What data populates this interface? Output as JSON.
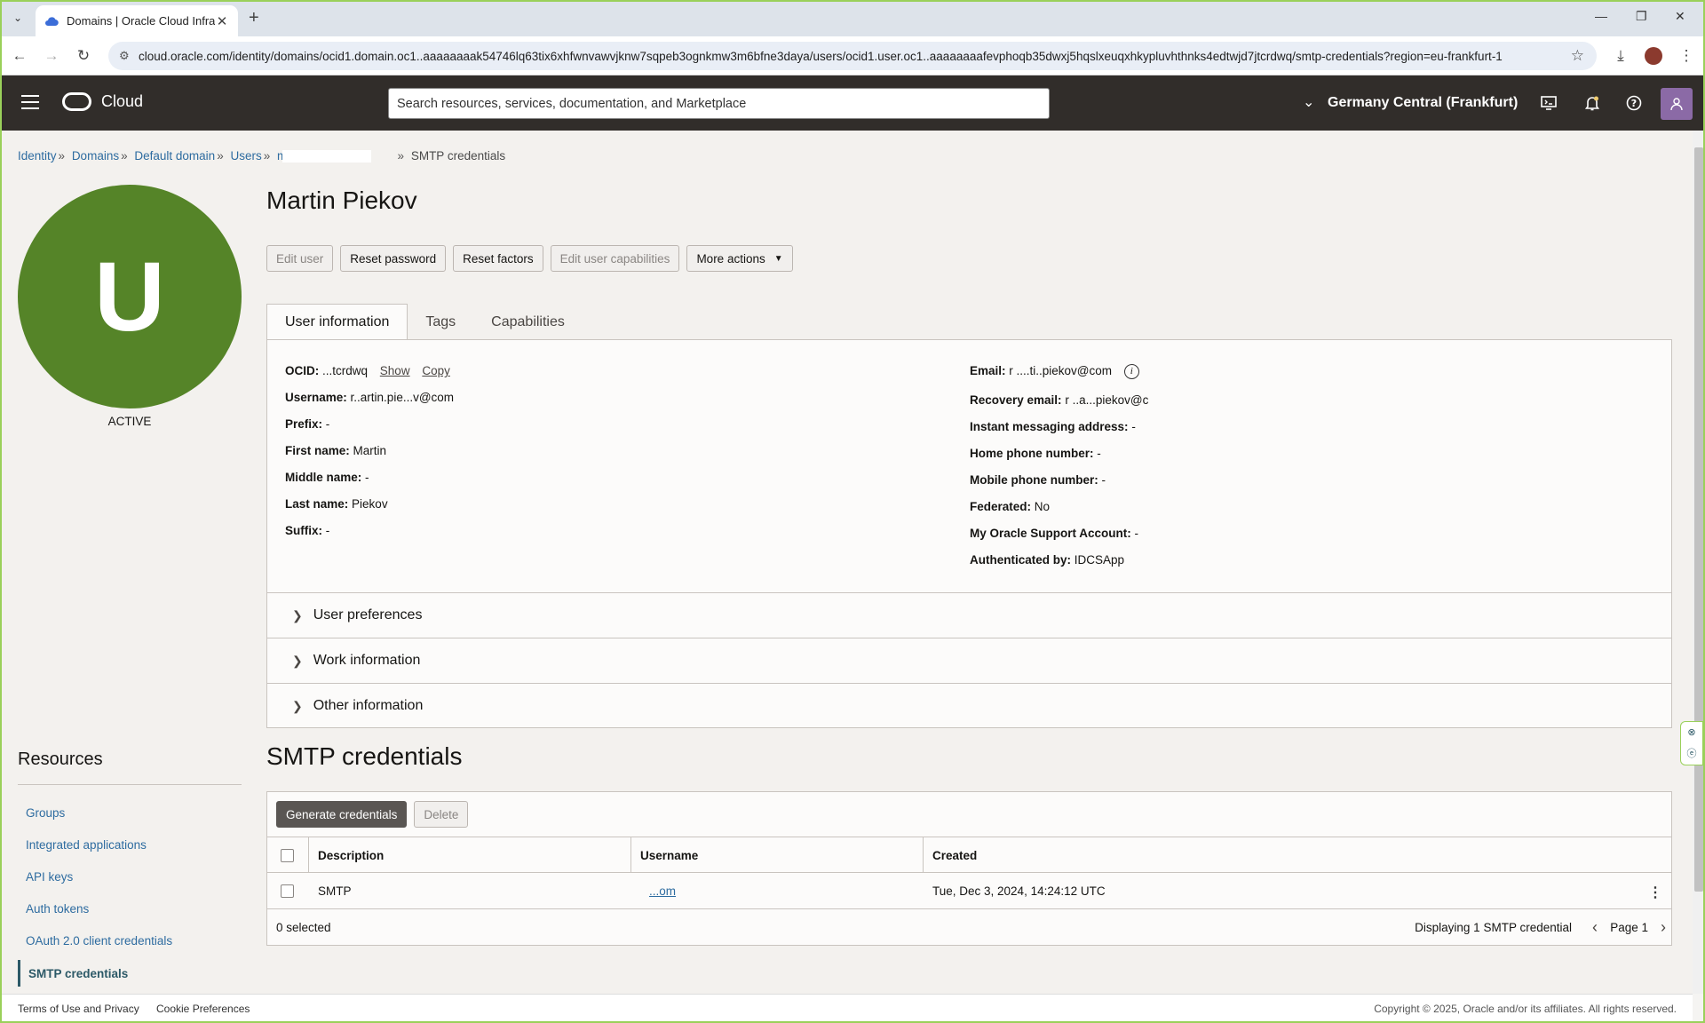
{
  "browser": {
    "tab_title": "Domains | Oracle Cloud Infrastr",
    "url": "cloud.oracle.com/identity/domains/ocid1.domain.oc1..aaaaaaaak54746lq63tix6xhfwnvawvjknw7sqpeb3ognkmw3m6bfne3daya/users/ocid1.user.oc1..aaaaaaaafevphoqb35dwxj5hqslxeuqxhkypluvhthnks4edtwjd7jtcrdwq/smtp-credentials?region=eu-frankfurt-1"
  },
  "header": {
    "brand": "Cloud",
    "search_placeholder": "Search resources, services, documentation, and Marketplace",
    "region": "Germany Central (Frankfurt)"
  },
  "breadcrumb": {
    "items": [
      "Identity",
      "Domains",
      "Default domain",
      "Users"
    ],
    "redacted_user": "martin",
    "current": "SMTP credentials"
  },
  "user": {
    "avatar_letter": "U",
    "status": "ACTIVE",
    "name": "Martin Piekov"
  },
  "actions": [
    "Edit user",
    "Reset password",
    "Reset factors",
    "Edit user capabilities",
    "More actions"
  ],
  "tabs": [
    "User information",
    "Tags",
    "Capabilities"
  ],
  "info_left": {
    "ocid_label": "OCID:",
    "ocid_value": "...tcrdwq",
    "show": "Show",
    "copy": "Copy",
    "username_label": "Username:",
    "username_value": "r..artin.pie...v@com",
    "prefix_label": "Prefix:",
    "prefix_value": "-",
    "first_label": "First name:",
    "first_value": "Martin",
    "middle_label": "Middle name:",
    "middle_value": "-",
    "last_label": "Last name:",
    "last_value": "Piekov",
    "suffix_label": "Suffix:",
    "suffix_value": "-"
  },
  "info_right": {
    "email_label": "Email:",
    "email_value": "r ....ti..piekov@com",
    "recovery_label": "Recovery email:",
    "recovery_value": "r ..a...piekov@c",
    "im_label": "Instant messaging address:",
    "im_value": "-",
    "home_label": "Home phone number:",
    "home_value": "-",
    "mobile_label": "Mobile phone number:",
    "mobile_value": "-",
    "fed_label": "Federated:",
    "fed_value": "No",
    "mos_label": "My Oracle Support Account:",
    "mos_value": "-",
    "auth_label": "Authenticated by:",
    "auth_value": "IDCSApp"
  },
  "accordions": [
    "User preferences",
    "Work information",
    "Other information"
  ],
  "resources": {
    "title": "Resources",
    "items": [
      "Groups",
      "Integrated applications",
      "API keys",
      "Auth tokens",
      "OAuth 2.0 client credentials",
      "SMTP credentials"
    ]
  },
  "smtp": {
    "title": "SMTP credentials",
    "generate": "Generate credentials",
    "delete": "Delete",
    "columns": [
      "Description",
      "Username",
      "Created"
    ],
    "rows": [
      {
        "description": "SMTP",
        "username": "...om",
        "created": "Tue, Dec 3, 2024, 14:24:12 UTC"
      }
    ],
    "selected": "0 selected",
    "displaying": "Displaying 1 SMTP credential",
    "page": "Page 1"
  },
  "footer": {
    "terms": "Terms of Use and Privacy",
    "cookies": "Cookie Preferences",
    "copyright": "Copyright © 2025, Oracle and/or its affiliates. All rights reserved."
  },
  "colors": {
    "header_bg": "#312d2a",
    "avatar_green": "#558428",
    "link": "#2e6ca0",
    "frame_accent": "#9ad05a"
  }
}
